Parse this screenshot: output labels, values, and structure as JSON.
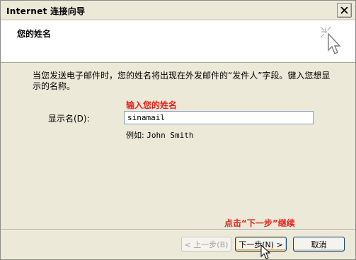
{
  "window": {
    "title": "Internet 连接向导"
  },
  "header": {
    "title": "您的姓名"
  },
  "description": "当您发送电子邮件时，您的姓名将出现在外发邮件的“发件人”字段。键入您想显示的名称。",
  "annotations": {
    "input_hint": "输入您的姓名",
    "next_hint": "点击“下一步”继续"
  },
  "form": {
    "display_name_label": "显示名(D):",
    "display_name_value": "sinamail",
    "example_prefix": "例如:",
    "example_name": "John Smith"
  },
  "buttons": {
    "back": "< 上一步(B)",
    "next": "下一步(N) >",
    "cancel": "取消"
  },
  "colors": {
    "annotation": "#e3221c",
    "window_bg": "#ece9d8",
    "header_bg": "#ffffff"
  }
}
